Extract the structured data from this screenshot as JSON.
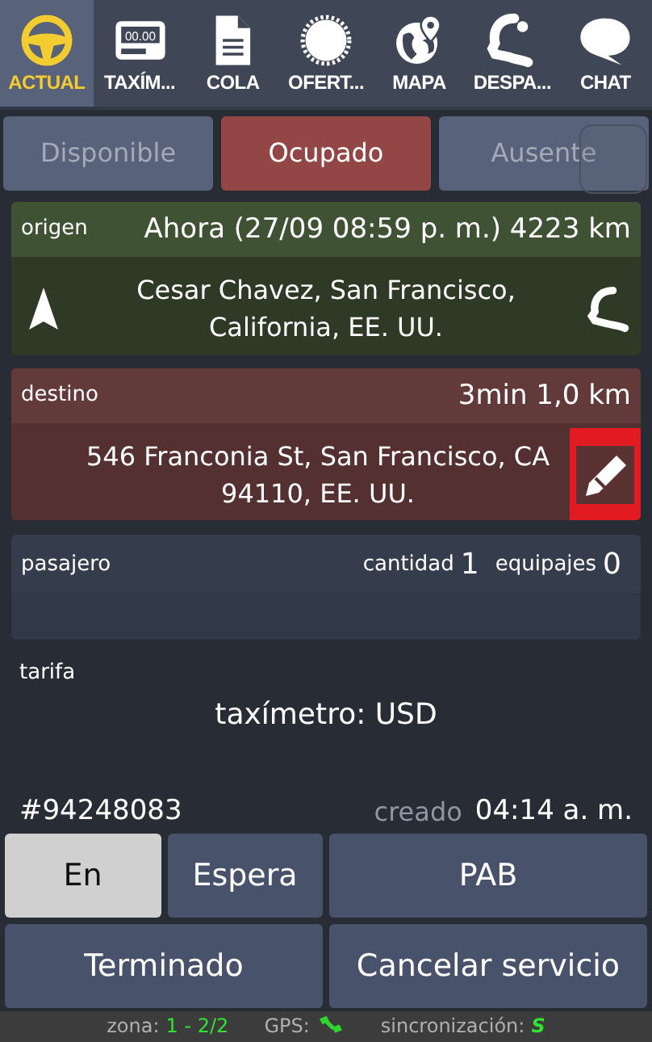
{
  "tabs": [
    {
      "label": "ACTUAL",
      "kind": "wheel",
      "selected": true
    },
    {
      "label": "TAXÍM...",
      "kind": "meter",
      "selected": false
    },
    {
      "label": "COLA",
      "kind": "doc",
      "selected": false
    },
    {
      "label": "OFERT...",
      "kind": "burst",
      "selected": false
    },
    {
      "label": "MAPA",
      "kind": "globe",
      "selected": false
    },
    {
      "label": "DESPA...",
      "kind": "headset",
      "selected": false
    },
    {
      "label": "CHAT",
      "kind": "chat",
      "selected": false
    }
  ],
  "meter_display": "00.00",
  "status_buttons": [
    {
      "label": "Disponible",
      "selected": false,
      "disabled": true
    },
    {
      "label": "Ocupado",
      "selected": true,
      "disabled": false
    },
    {
      "label": "Ausente",
      "selected": false,
      "disabled": true
    }
  ],
  "origin": {
    "label": "origen",
    "info": "Ahora (27/09 08:59 p. m.) 4223 km",
    "address": "Cesar Chavez, San Francisco, California, EE. UU."
  },
  "destination": {
    "label": "destino",
    "info": "3min 1,0 km",
    "address": "546 Franconia St, San Francisco, CA 94110, EE. UU."
  },
  "passenger": {
    "label": "pasajero",
    "count_label": "cantidad",
    "count": "1",
    "luggage_label": "equipajes",
    "luggage": "0"
  },
  "fare": {
    "label": "tarifa",
    "value": "taxímetro: USD"
  },
  "order": {
    "id": "#94248083",
    "created_label": "creado",
    "created": "04:14 a. m."
  },
  "action_buttons": [
    {
      "label": "En",
      "selected": true,
      "wide": false
    },
    {
      "label": "Espera",
      "selected": false,
      "wide": false
    },
    {
      "label": "PAB",
      "selected": false,
      "wide": true
    },
    {
      "label": "Terminado",
      "selected": false,
      "wide": true
    },
    {
      "label": "Cancelar servicio",
      "selected": false,
      "wide": true
    }
  ],
  "status_bar": {
    "zone_label": "zona:",
    "zone": "1 - 2/2",
    "gps_label": "GPS:",
    "sync_label": "sincronización:",
    "sync": "S"
  }
}
